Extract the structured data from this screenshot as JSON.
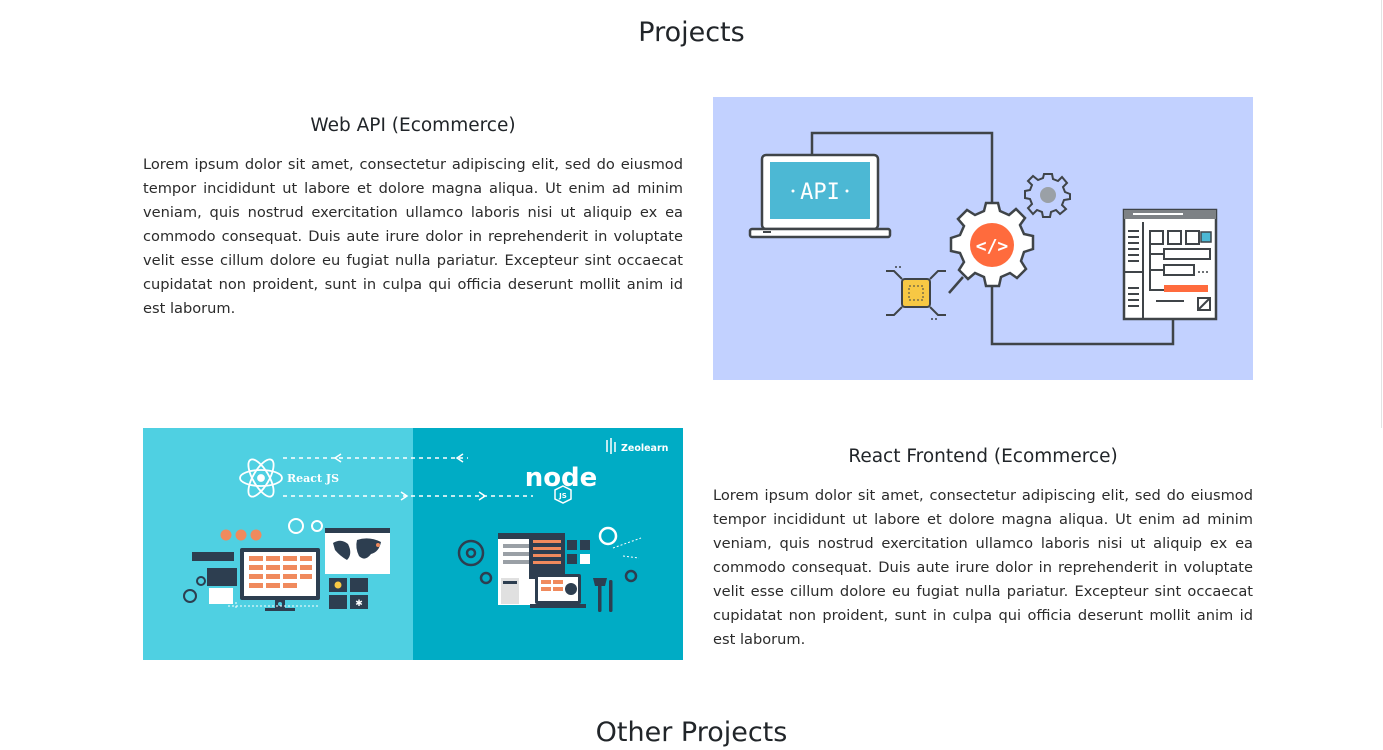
{
  "sections": {
    "projects_title": "Projects",
    "other_projects_title": "Other Projects"
  },
  "projects": [
    {
      "title": "Web API (Ecommerce)",
      "description": "Lorem ipsum dolor sit amet, consectetur adipiscing elit, sed do eiusmod tempor incididunt ut labore et dolore magna aliqua. Ut enim ad minim veniam, quis nostrud exercitation ullamco laboris nisi ut aliquip ex ea commodo consequat. Duis aute irure dolor in reprehenderit in voluptate velit esse cillum dolore eu fugiat nulla pariatur. Excepteur sint occaecat cupidatat non proident, sunt in culpa qui officia deserunt mollit anim id est laborum.",
      "image": {
        "icon": "api-illustration",
        "label": "API",
        "background": "#c2d1ff"
      }
    },
    {
      "title": "React Frontend (Ecommerce)",
      "description": "Lorem ipsum dolor sit amet, consectetur adipiscing elit, sed do eiusmod tempor incididunt ut labore et dolore magna aliqua. Ut enim ad minim veniam, quis nostrud exercitation ullamco laboris nisi ut aliquip ex ea commodo consequat. Duis aute irure dolor in reprehenderit in voluptate velit esse cillum dolore eu fugiat nulla pariatur. Excepteur sint occaecat cupidatat non proident, sunt in culpa qui officia deserunt mollit anim id est laborum.",
      "image": {
        "icon": "react-node-illustration",
        "react_label": "React JS",
        "node_label": "node",
        "js_badge": "JS",
        "brand": "Zeolearn",
        "left_bg": "#4fd0e2",
        "right_bg": "#00acc5"
      }
    }
  ]
}
